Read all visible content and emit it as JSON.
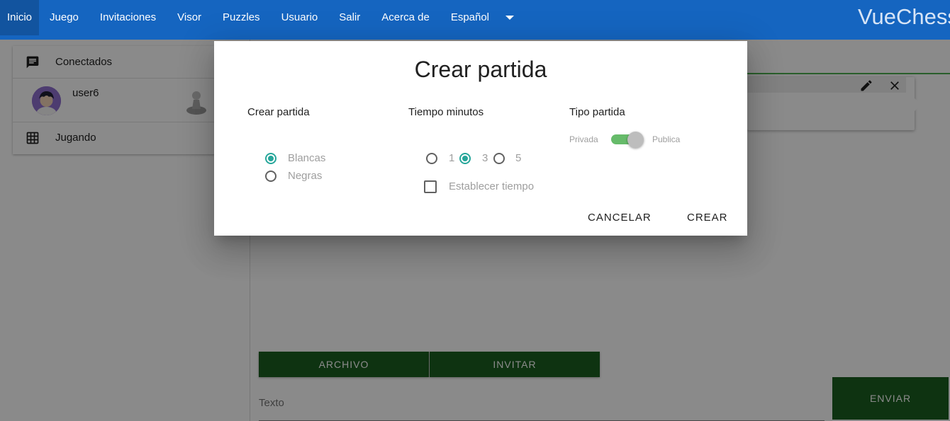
{
  "nav": {
    "items": [
      "Inicio",
      "Juego",
      "Invitaciones",
      "Visor",
      "Puzzles",
      "Usuario",
      "Salir",
      "Acerca de",
      "Español"
    ],
    "brand": "VueChess",
    "color": "#1565c0"
  },
  "left_panel": {
    "connected_label": "Conectados",
    "user_name": "user6",
    "playing_label": "Jugando"
  },
  "chat": {
    "file_button": "ARCHIVO",
    "invite_button": "INVITAR",
    "text_placeholder": "Texto",
    "send_button": "ENVIAR",
    "button_color": "#1b5e20"
  },
  "dialog": {
    "title": "Crear partida",
    "color_section": {
      "title": "Crear partida",
      "options": [
        "Blancas",
        "Negras"
      ],
      "selected": "Blancas"
    },
    "time_section": {
      "title": "Tiempo minutos",
      "options": [
        "1",
        "3",
        "5"
      ],
      "selected": "3",
      "custom_time_label": "Establecer tiempo",
      "custom_time_checked": false
    },
    "type_section": {
      "title": "Tipo partida",
      "off_label": "Privada",
      "on_label": "Publica",
      "is_public": true
    },
    "cancel_label": "CANCELAR",
    "create_label": "CREAR",
    "accent_color": "#26a69a"
  }
}
